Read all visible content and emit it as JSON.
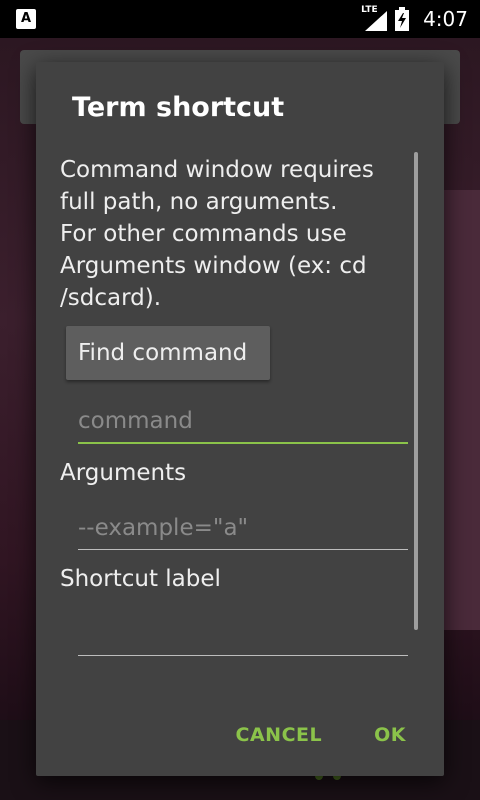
{
  "status_bar": {
    "notification_icon": "app-notification-icon",
    "notification_letter": "A",
    "network_label": "LTE",
    "network_icon": "signal-icon",
    "battery_icon": "battery-charging-icon",
    "time": "4:07"
  },
  "dialog": {
    "title": "Term shortcut",
    "message": "Command window requires full path, no arguments.\nFor other commands use Arguments window (ex: cd /sdcard).",
    "find_command_label": "Find command",
    "command_placeholder": "command",
    "command_value": "",
    "arguments_label": "Arguments",
    "arguments_placeholder": "--example=\"a\"",
    "arguments_value": "",
    "shortcut_label_label": "Shortcut label",
    "shortcut_label_value": "",
    "cancel_label": "CANCEL",
    "ok_label": "OK"
  },
  "colors": {
    "accent": "#8bc34a",
    "dialog_bg": "#424242"
  }
}
